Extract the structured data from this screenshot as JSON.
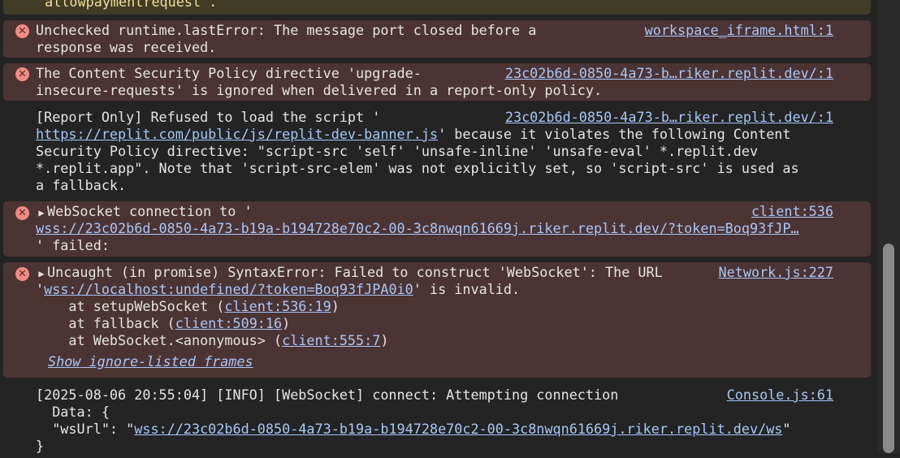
{
  "top_partial": "'allowpaymentrequest'.",
  "messages": {
    "m1": {
      "line1": "Unchecked runtime.lastError: The message port closed before a",
      "line2": "response was received.",
      "source": "workspace_iframe.html:1"
    },
    "m2": {
      "line1": "The Content Security Policy directive 'upgrade-",
      "line2": "insecure-requests' is ignored when delivered in a report-only policy.",
      "source": "23c02b6d-0850-4a73-b…riker.replit.dev/:1"
    },
    "m3": {
      "line1": "[Report Only] Refused to load the script '",
      "url": "https://replit.com/public/js/replit-dev-banner.js",
      "line2_rest": "' because it violates the following Content",
      "line3": "Security Policy directive: \"script-src 'self' 'unsafe-inline' 'unsafe-eval' *.replit.dev",
      "line4": "*.replit.app\". Note that 'script-src-elem' was not explicitly set, so 'script-src' is used as",
      "line5": "a fallback.",
      "source": "23c02b6d-0850-4a73-b…riker.replit.dev/:1"
    },
    "m4": {
      "line1": "WebSocket connection to '",
      "url": "wss://23c02b6d-0850-4a73-b19a-b194728e70c2-00-3c8nwqn61669j.riker.replit.dev/?token=Boq93fJP…",
      "line3": "' failed:",
      "source": "client:536"
    },
    "m5": {
      "line1": "Uncaught (in promise) SyntaxError: Failed to construct 'WebSocket': The URL",
      "quote_open": "'",
      "url": "wss://localhost:undefined/?token=Boq93fJPA0i0",
      "line2_rest": "' is invalid.",
      "stack": [
        {
          "prefix": "    at setupWebSocket (",
          "link": "client:536:19",
          "suffix": ")"
        },
        {
          "prefix": "    at fallback (",
          "link": "client:509:16",
          "suffix": ")"
        },
        {
          "prefix": "    at WebSocket.<anonymous> (",
          "link": "client:555:7",
          "suffix": ")"
        }
      ],
      "show_ignored": "Show ignore-listed frames",
      "source": "Network.js:227"
    },
    "m6": {
      "line1": "[2025-08-06 20:55:04] [INFO] [WebSocket] connect: Attempting connection",
      "line2": "  Data: {",
      "line3_prefix": "  \"wsUrl\": \"",
      "url": "wss://23c02b6d-0850-4a73-b19a-b194728e70c2-00-3c8nwqn61669j.riker.replit.dev/ws",
      "line3_suffix": "\"",
      "line4": "}",
      "source": "Console.js:61"
    }
  },
  "icons": {
    "error": "error-circle-icon",
    "expand": "expand-triangle-icon"
  },
  "colors": {
    "background": "#242424",
    "error_bg": "#4d3434",
    "warning_bg": "#413c26",
    "link": "#a8c7fa",
    "error_icon": "#f28b82"
  }
}
